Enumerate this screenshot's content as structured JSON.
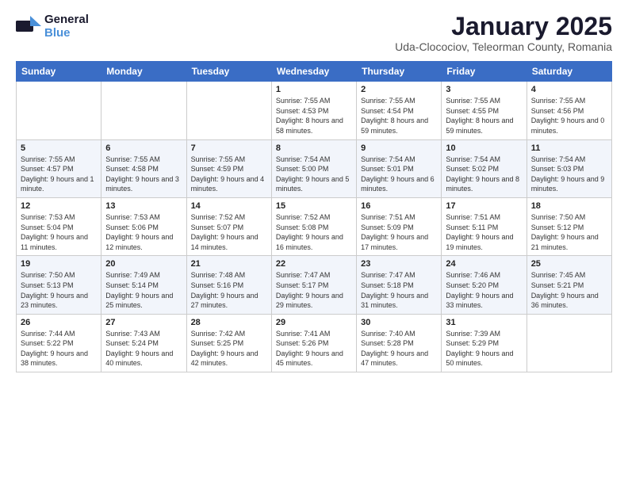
{
  "header": {
    "logo_general": "General",
    "logo_blue": "Blue",
    "month_title": "January 2025",
    "location": "Uda-Clocociov, Teleorman County, Romania"
  },
  "weekdays": [
    "Sunday",
    "Monday",
    "Tuesday",
    "Wednesday",
    "Thursday",
    "Friday",
    "Saturday"
  ],
  "weeks": [
    [
      {
        "day": "",
        "info": ""
      },
      {
        "day": "",
        "info": ""
      },
      {
        "day": "",
        "info": ""
      },
      {
        "day": "1",
        "info": "Sunrise: 7:55 AM\nSunset: 4:53 PM\nDaylight: 8 hours and 58 minutes."
      },
      {
        "day": "2",
        "info": "Sunrise: 7:55 AM\nSunset: 4:54 PM\nDaylight: 8 hours and 59 minutes."
      },
      {
        "day": "3",
        "info": "Sunrise: 7:55 AM\nSunset: 4:55 PM\nDaylight: 8 hours and 59 minutes."
      },
      {
        "day": "4",
        "info": "Sunrise: 7:55 AM\nSunset: 4:56 PM\nDaylight: 9 hours and 0 minutes."
      }
    ],
    [
      {
        "day": "5",
        "info": "Sunrise: 7:55 AM\nSunset: 4:57 PM\nDaylight: 9 hours and 1 minute."
      },
      {
        "day": "6",
        "info": "Sunrise: 7:55 AM\nSunset: 4:58 PM\nDaylight: 9 hours and 3 minutes."
      },
      {
        "day": "7",
        "info": "Sunrise: 7:55 AM\nSunset: 4:59 PM\nDaylight: 9 hours and 4 minutes."
      },
      {
        "day": "8",
        "info": "Sunrise: 7:54 AM\nSunset: 5:00 PM\nDaylight: 9 hours and 5 minutes."
      },
      {
        "day": "9",
        "info": "Sunrise: 7:54 AM\nSunset: 5:01 PM\nDaylight: 9 hours and 6 minutes."
      },
      {
        "day": "10",
        "info": "Sunrise: 7:54 AM\nSunset: 5:02 PM\nDaylight: 9 hours and 8 minutes."
      },
      {
        "day": "11",
        "info": "Sunrise: 7:54 AM\nSunset: 5:03 PM\nDaylight: 9 hours and 9 minutes."
      }
    ],
    [
      {
        "day": "12",
        "info": "Sunrise: 7:53 AM\nSunset: 5:04 PM\nDaylight: 9 hours and 11 minutes."
      },
      {
        "day": "13",
        "info": "Sunrise: 7:53 AM\nSunset: 5:06 PM\nDaylight: 9 hours and 12 minutes."
      },
      {
        "day": "14",
        "info": "Sunrise: 7:52 AM\nSunset: 5:07 PM\nDaylight: 9 hours and 14 minutes."
      },
      {
        "day": "15",
        "info": "Sunrise: 7:52 AM\nSunset: 5:08 PM\nDaylight: 9 hours and 16 minutes."
      },
      {
        "day": "16",
        "info": "Sunrise: 7:51 AM\nSunset: 5:09 PM\nDaylight: 9 hours and 17 minutes."
      },
      {
        "day": "17",
        "info": "Sunrise: 7:51 AM\nSunset: 5:11 PM\nDaylight: 9 hours and 19 minutes."
      },
      {
        "day": "18",
        "info": "Sunrise: 7:50 AM\nSunset: 5:12 PM\nDaylight: 9 hours and 21 minutes."
      }
    ],
    [
      {
        "day": "19",
        "info": "Sunrise: 7:50 AM\nSunset: 5:13 PM\nDaylight: 9 hours and 23 minutes."
      },
      {
        "day": "20",
        "info": "Sunrise: 7:49 AM\nSunset: 5:14 PM\nDaylight: 9 hours and 25 minutes."
      },
      {
        "day": "21",
        "info": "Sunrise: 7:48 AM\nSunset: 5:16 PM\nDaylight: 9 hours and 27 minutes."
      },
      {
        "day": "22",
        "info": "Sunrise: 7:47 AM\nSunset: 5:17 PM\nDaylight: 9 hours and 29 minutes."
      },
      {
        "day": "23",
        "info": "Sunrise: 7:47 AM\nSunset: 5:18 PM\nDaylight: 9 hours and 31 minutes."
      },
      {
        "day": "24",
        "info": "Sunrise: 7:46 AM\nSunset: 5:20 PM\nDaylight: 9 hours and 33 minutes."
      },
      {
        "day": "25",
        "info": "Sunrise: 7:45 AM\nSunset: 5:21 PM\nDaylight: 9 hours and 36 minutes."
      }
    ],
    [
      {
        "day": "26",
        "info": "Sunrise: 7:44 AM\nSunset: 5:22 PM\nDaylight: 9 hours and 38 minutes."
      },
      {
        "day": "27",
        "info": "Sunrise: 7:43 AM\nSunset: 5:24 PM\nDaylight: 9 hours and 40 minutes."
      },
      {
        "day": "28",
        "info": "Sunrise: 7:42 AM\nSunset: 5:25 PM\nDaylight: 9 hours and 42 minutes."
      },
      {
        "day": "29",
        "info": "Sunrise: 7:41 AM\nSunset: 5:26 PM\nDaylight: 9 hours and 45 minutes."
      },
      {
        "day": "30",
        "info": "Sunrise: 7:40 AM\nSunset: 5:28 PM\nDaylight: 9 hours and 47 minutes."
      },
      {
        "day": "31",
        "info": "Sunrise: 7:39 AM\nSunset: 5:29 PM\nDaylight: 9 hours and 50 minutes."
      },
      {
        "day": "",
        "info": ""
      }
    ]
  ]
}
